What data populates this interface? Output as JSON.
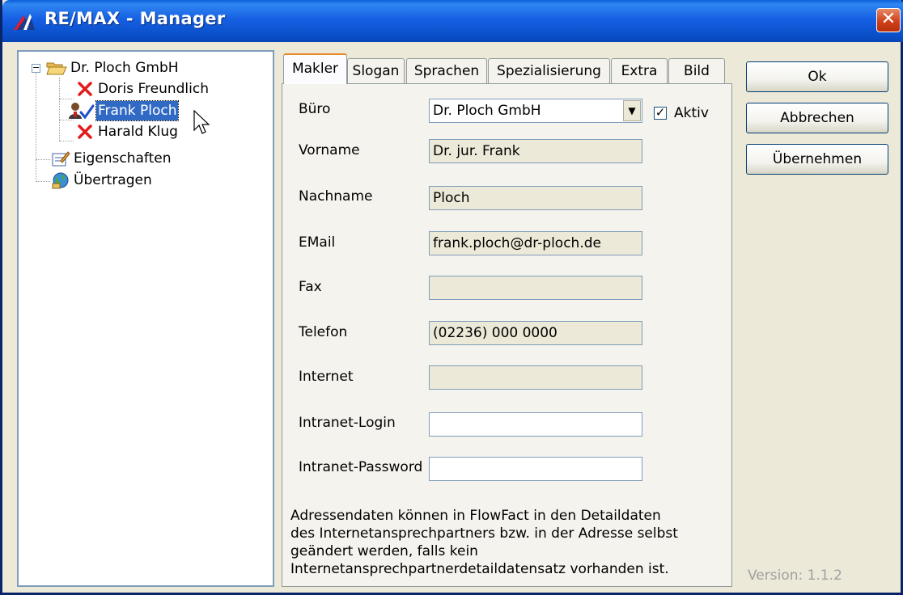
{
  "window": {
    "title": "RE/MAX - Manager",
    "close_label": "✕"
  },
  "tree": {
    "root_label": "Dr. Ploch GmbH",
    "items": [
      {
        "label": "Doris Freundlich",
        "icon": "red-x-icon"
      },
      {
        "label": "Frank Ploch",
        "icon": "agent-check-icon",
        "selected": true
      },
      {
        "label": "Harald Klug",
        "icon": "red-x-icon"
      }
    ],
    "props_label": "Eigenschaften",
    "transfer_label": "Übertragen"
  },
  "tabs": [
    "Makler",
    "Slogan",
    "Sprachen",
    "Spezialisierung",
    "Extra",
    "Bild"
  ],
  "active_tab": "Makler",
  "form": {
    "buero_label": "Büro",
    "buero_value": "Dr. Ploch GmbH",
    "aktiv_label": "Aktiv",
    "aktiv_checked": true,
    "vorname_label": "Vorname",
    "vorname_value": "Dr. jur. Frank",
    "nachname_label": "Nachname",
    "nachname_value": "Ploch",
    "email_label": "EMail",
    "email_value": "frank.ploch@dr-ploch.de",
    "fax_label": "Fax",
    "fax_value": "",
    "telefon_label": "Telefon",
    "telefon_value": "(02236) 000 0000",
    "internet_label": "Internet",
    "internet_value": "",
    "login_label": "Intranet-Login",
    "login_value": "",
    "password_label": "Intranet-Password",
    "password_value": ""
  },
  "note": {
    "line1": "Adressendaten können in FlowFact in den Detaildaten",
    "line2": "des Internetansprechpartners bzw. in der Adresse selbst",
    "line3": "geändert werden, falls kein",
    "line4": "Internetansprechpartnerdetaildatensatz vorhanden ist."
  },
  "buttons": {
    "ok": "Ok",
    "cancel": "Abbrechen",
    "apply": "Übernehmen"
  },
  "version": "Version: 1.1.2",
  "colors": {
    "titlebar": "#0A5FD8",
    "selection": "#316AC5",
    "panel": "#ECE9D8"
  }
}
